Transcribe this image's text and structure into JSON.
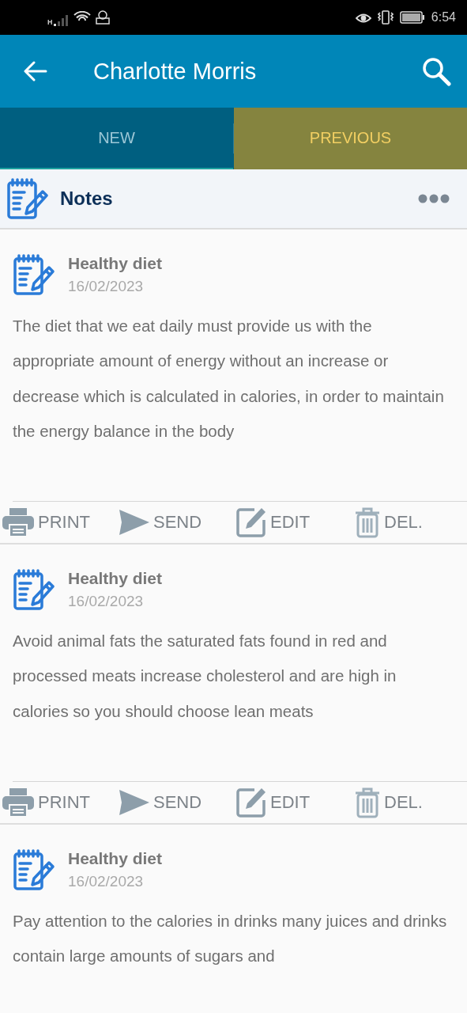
{
  "status_bar": {
    "network_type": "H",
    "time": "6:54"
  },
  "header": {
    "title": "Charlotte Morris"
  },
  "tabs": [
    {
      "label": "NEW",
      "selected": false
    },
    {
      "label": "PREVIOUS",
      "selected": true
    }
  ],
  "section": {
    "title": "Notes"
  },
  "notes": [
    {
      "title": "Healthy diet",
      "date": "16/02/2023",
      "text": "The diet that we eat daily must provide us with the appropriate amount of energy without an increase or decrease which is calculated in calories, in order to maintain the energy balance in the body",
      "actions": [
        {
          "kind": "print",
          "label": "PRINT"
        },
        {
          "kind": "send",
          "label": "SEND"
        },
        {
          "kind": "edit",
          "label": "EDIT"
        },
        {
          "kind": "delete",
          "label": "DEL."
        }
      ]
    },
    {
      "title": "Healthy diet",
      "date": "16/02/2023",
      "text": "Avoid animal fats the saturated fats found in red and processed meats increase cholesterol and are high in calories so you should choose lean meats",
      "actions": [
        {
          "kind": "print",
          "label": "PRINT"
        },
        {
          "kind": "send",
          "label": "SEND"
        },
        {
          "kind": "edit",
          "label": "EDIT"
        },
        {
          "kind": "delete",
          "label": "DEL."
        }
      ]
    },
    {
      "title": "Healthy diet",
      "date": "16/02/2023",
      "text": "Pay attention to the calories in drinks many juices and drinks contain large amounts of sugars and"
    }
  ]
}
